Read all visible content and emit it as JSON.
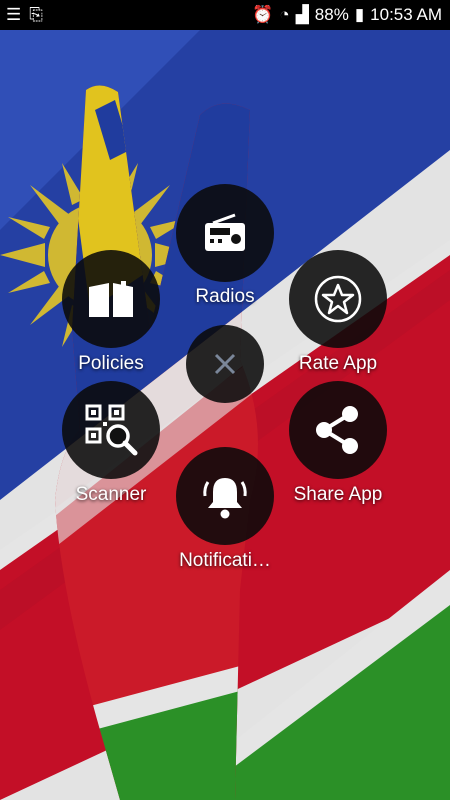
{
  "status_bar": {
    "battery_percent": "88%",
    "time": "10:53 AM"
  },
  "menu": {
    "items": [
      {
        "label": "Radios",
        "icon": "radio-icon"
      },
      {
        "label": "Policies",
        "icon": "book-icon"
      },
      {
        "label": "Rate App",
        "icon": "star-icon"
      },
      {
        "label": "Scanner",
        "icon": "qr-scanner-icon"
      },
      {
        "label": "Share App",
        "icon": "share-icon"
      },
      {
        "label": "Notificati…",
        "icon": "bell-icon"
      }
    ],
    "close_icon": "close-icon"
  },
  "colors": {
    "flag_blue": "#1f3fa8",
    "flag_red": "#d0102a",
    "flag_green": "#2e9a2a",
    "flag_white": "#f4f4f4",
    "sun_yellow": "#f2d22a"
  }
}
